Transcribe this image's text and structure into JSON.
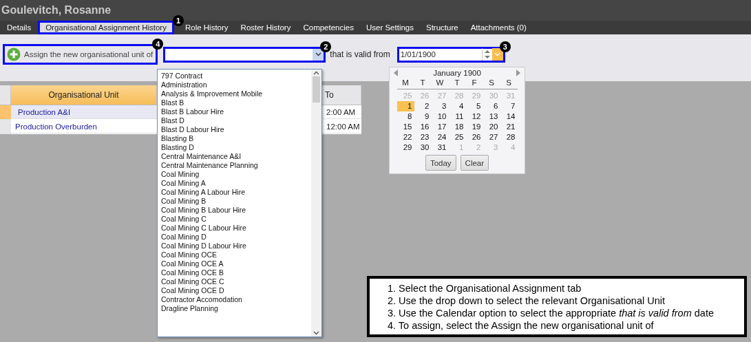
{
  "window": {
    "title": "Goulevitch, Rosanne"
  },
  "tabs": [
    {
      "label": "Details",
      "selected": false
    },
    {
      "label": "Organisational Assignment History",
      "selected": true,
      "callout": "1"
    },
    {
      "label": "Role History",
      "selected": false
    },
    {
      "label": "Roster History",
      "selected": false
    },
    {
      "label": "Competencies",
      "selected": false
    },
    {
      "label": "User Settings",
      "selected": false
    },
    {
      "label": "Structure",
      "selected": false
    },
    {
      "label": "Attachments (0)",
      "selected": false
    }
  ],
  "toolbar": {
    "assign_button": {
      "label": "Assign the new organisational unit of",
      "callout": "4"
    },
    "unit_combo": {
      "callout": "2",
      "expanded": true
    },
    "valid_from_label": "that is valid from",
    "date_field": {
      "value": "1/01/1900",
      "callout": "3",
      "expanded": true
    }
  },
  "unit_dropdown": {
    "items": [
      "797 Contract",
      "Administration",
      "Analysis & Improvement Mobile",
      "Blast B",
      "Blast B Labour Hire",
      "Blast D",
      "Blast D Labour Hire",
      "Blasting B",
      "Blasting D",
      "Central Maintenance A&I",
      "Central Maintenance Planning",
      "Coal Mining",
      "Coal Mining A",
      "Coal Mining A Labour Hire",
      "Coal Mining B",
      "Coal Mining B Labour Hire",
      "Coal Mining C",
      "Coal Mining C Labour Hire",
      "Coal Mining D",
      "Coal Mining D Labour Hire",
      "Coal Mining OCE",
      "Coal Mining OCE A",
      "Coal Mining OCE B",
      "Coal Mining OCE C",
      "Coal Mining OCE D",
      "Contractor Accomodation",
      "Dragline Planning"
    ]
  },
  "calendar": {
    "month": "January 1900",
    "weekdays": [
      "M",
      "T",
      "W",
      "T",
      "F",
      "S",
      "S"
    ],
    "days": [
      {
        "label": "25",
        "in_month": false,
        "selected": false
      },
      {
        "label": "26",
        "in_month": false,
        "selected": false
      },
      {
        "label": "27",
        "in_month": false,
        "selected": false
      },
      {
        "label": "28",
        "in_month": false,
        "selected": false
      },
      {
        "label": "29",
        "in_month": false,
        "selected": false
      },
      {
        "label": "30",
        "in_month": false,
        "selected": false
      },
      {
        "label": "31",
        "in_month": false,
        "selected": false
      },
      {
        "label": "1",
        "in_month": true,
        "selected": true
      },
      {
        "label": "2",
        "in_month": true,
        "selected": false
      },
      {
        "label": "3",
        "in_month": true,
        "selected": false
      },
      {
        "label": "4",
        "in_month": true,
        "selected": false
      },
      {
        "label": "5",
        "in_month": true,
        "selected": false
      },
      {
        "label": "6",
        "in_month": true,
        "selected": false
      },
      {
        "label": "7",
        "in_month": true,
        "selected": false
      },
      {
        "label": "8",
        "in_month": true,
        "selected": false
      },
      {
        "label": "9",
        "in_month": true,
        "selected": false
      },
      {
        "label": "10",
        "in_month": true,
        "selected": false
      },
      {
        "label": "11",
        "in_month": true,
        "selected": false
      },
      {
        "label": "12",
        "in_month": true,
        "selected": false
      },
      {
        "label": "13",
        "in_month": true,
        "selected": false
      },
      {
        "label": "14",
        "in_month": true,
        "selected": false
      },
      {
        "label": "15",
        "in_month": true,
        "selected": false
      },
      {
        "label": "16",
        "in_month": true,
        "selected": false
      },
      {
        "label": "17",
        "in_month": true,
        "selected": false
      },
      {
        "label": "18",
        "in_month": true,
        "selected": false
      },
      {
        "label": "19",
        "in_month": true,
        "selected": false
      },
      {
        "label": "20",
        "in_month": true,
        "selected": false
      },
      {
        "label": "21",
        "in_month": true,
        "selected": false
      },
      {
        "label": "22",
        "in_month": true,
        "selected": false
      },
      {
        "label": "23",
        "in_month": true,
        "selected": false
      },
      {
        "label": "24",
        "in_month": true,
        "selected": false
      },
      {
        "label": "25",
        "in_month": true,
        "selected": false
      },
      {
        "label": "26",
        "in_month": true,
        "selected": false
      },
      {
        "label": "27",
        "in_month": true,
        "selected": false
      },
      {
        "label": "28",
        "in_month": true,
        "selected": false
      },
      {
        "label": "29",
        "in_month": true,
        "selected": false
      },
      {
        "label": "30",
        "in_month": true,
        "selected": false
      },
      {
        "label": "31",
        "in_month": true,
        "selected": false
      },
      {
        "label": "1",
        "in_month": false,
        "selected": false
      },
      {
        "label": "2",
        "in_month": false,
        "selected": false
      },
      {
        "label": "3",
        "in_month": false,
        "selected": false
      },
      {
        "label": "4",
        "in_month": false,
        "selected": false
      }
    ],
    "buttons": [
      "Today",
      "Clear"
    ]
  },
  "table": {
    "columns": [
      "Organisational Unit",
      "To"
    ],
    "rows": [
      {
        "cells": [
          "Production A&I",
          "2:00 AM"
        ],
        "selected": true
      },
      {
        "cells": [
          "Production Overburden",
          "12:00 AM"
        ],
        "selected": false
      }
    ]
  },
  "instructions": [
    "1. Select the Organisational Assignment tab",
    "2. Use the drop down to select the relevant Organisational Unit",
    "3. Use the Calendar option to select the appropriate *that is valid from* date",
    "4. To assign, select the Assign the new organisational unit of"
  ]
}
